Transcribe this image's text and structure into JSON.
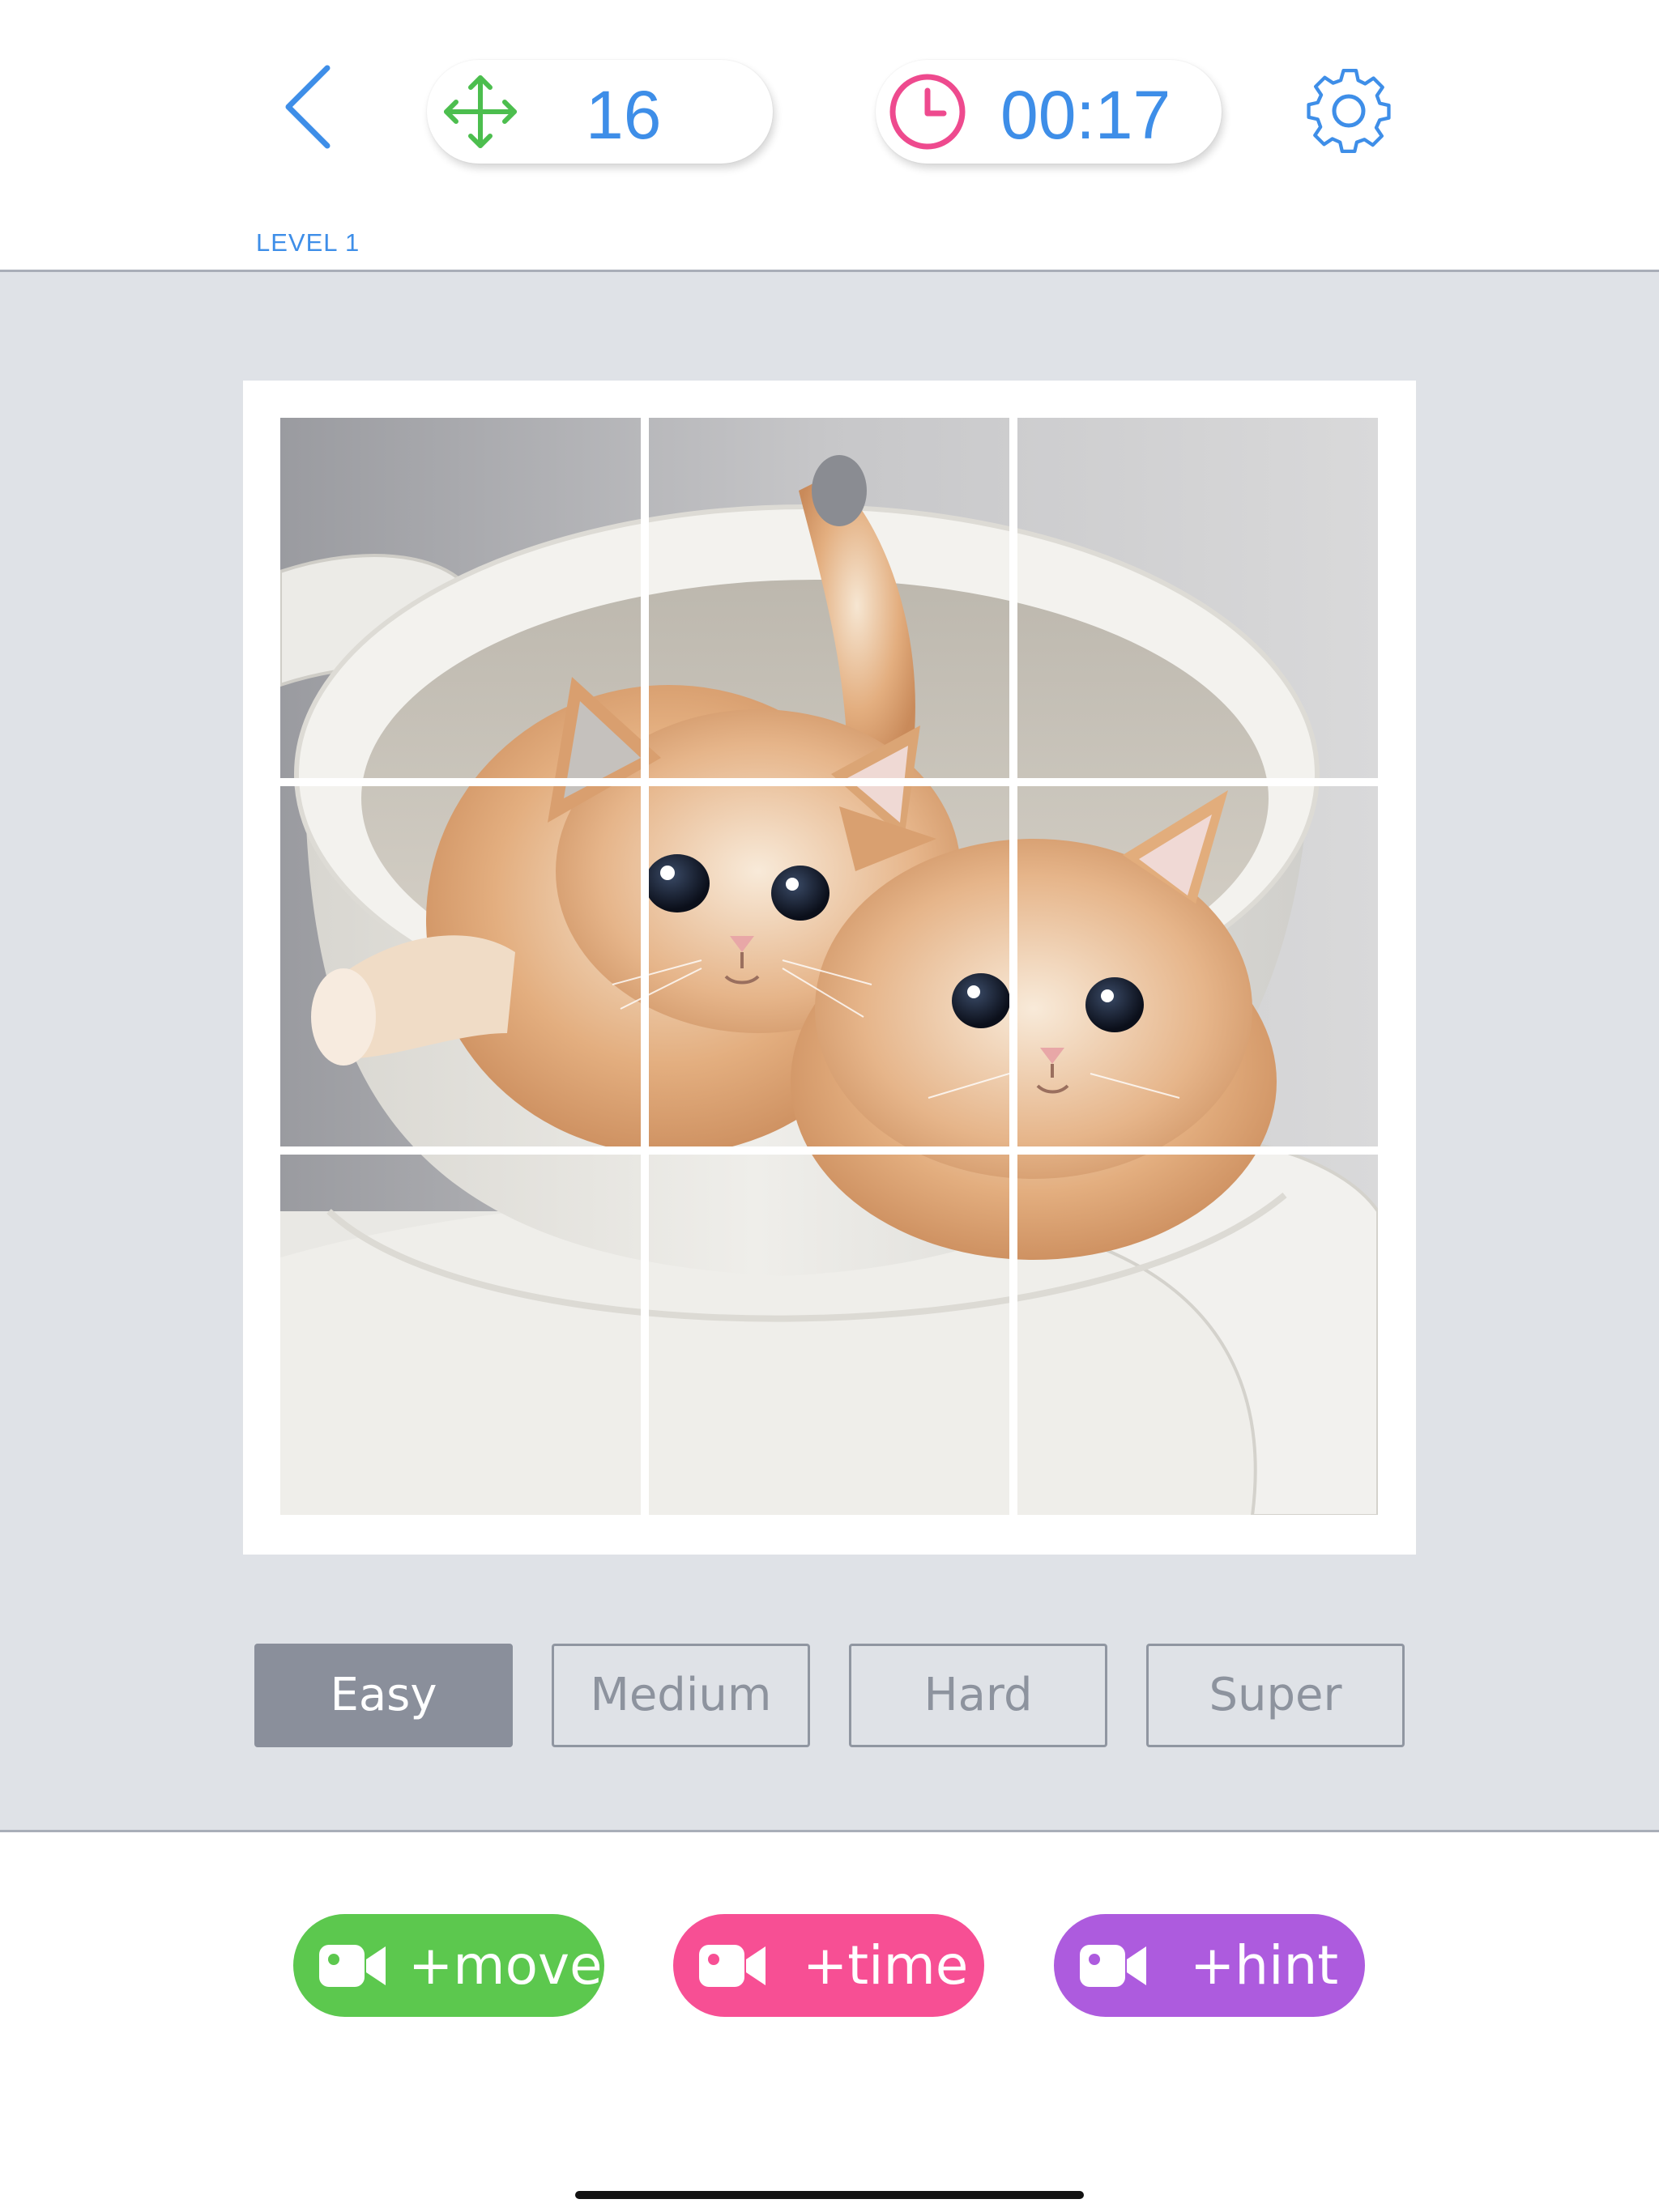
{
  "header": {
    "moves": "16",
    "time": "00:17",
    "level": "LEVEL 1",
    "icons": {
      "back": "back-chevron-icon",
      "moves": "move-arrows-icon",
      "time": "clock-icon",
      "settings": "gear-icon"
    }
  },
  "puzzle": {
    "grid": "3x3",
    "subject": "two kittens in a teacup",
    "tile_order": [
      1,
      2,
      3,
      4,
      5,
      6,
      7,
      8,
      9
    ]
  },
  "difficulty": {
    "options": [
      "Easy",
      "Medium",
      "Hard",
      "Super"
    ],
    "selected": "Easy"
  },
  "boosts": [
    {
      "label": "+move",
      "color": "#5cc84e",
      "icon": "video-camera-icon"
    },
    {
      "label": "+time",
      "color": "#f74f94",
      "icon": "video-camera-icon"
    },
    {
      "label": "+hint",
      "color": "#ad5bde",
      "icon": "video-camera-icon"
    }
  ],
  "colors": {
    "accent_blue": "#3e8ee8",
    "move_green": "#4cbe4e",
    "clock_pink": "#ee4a8e",
    "play_area_bg": "#dfe2e7",
    "active_difficulty": "#8a8f9b"
  }
}
